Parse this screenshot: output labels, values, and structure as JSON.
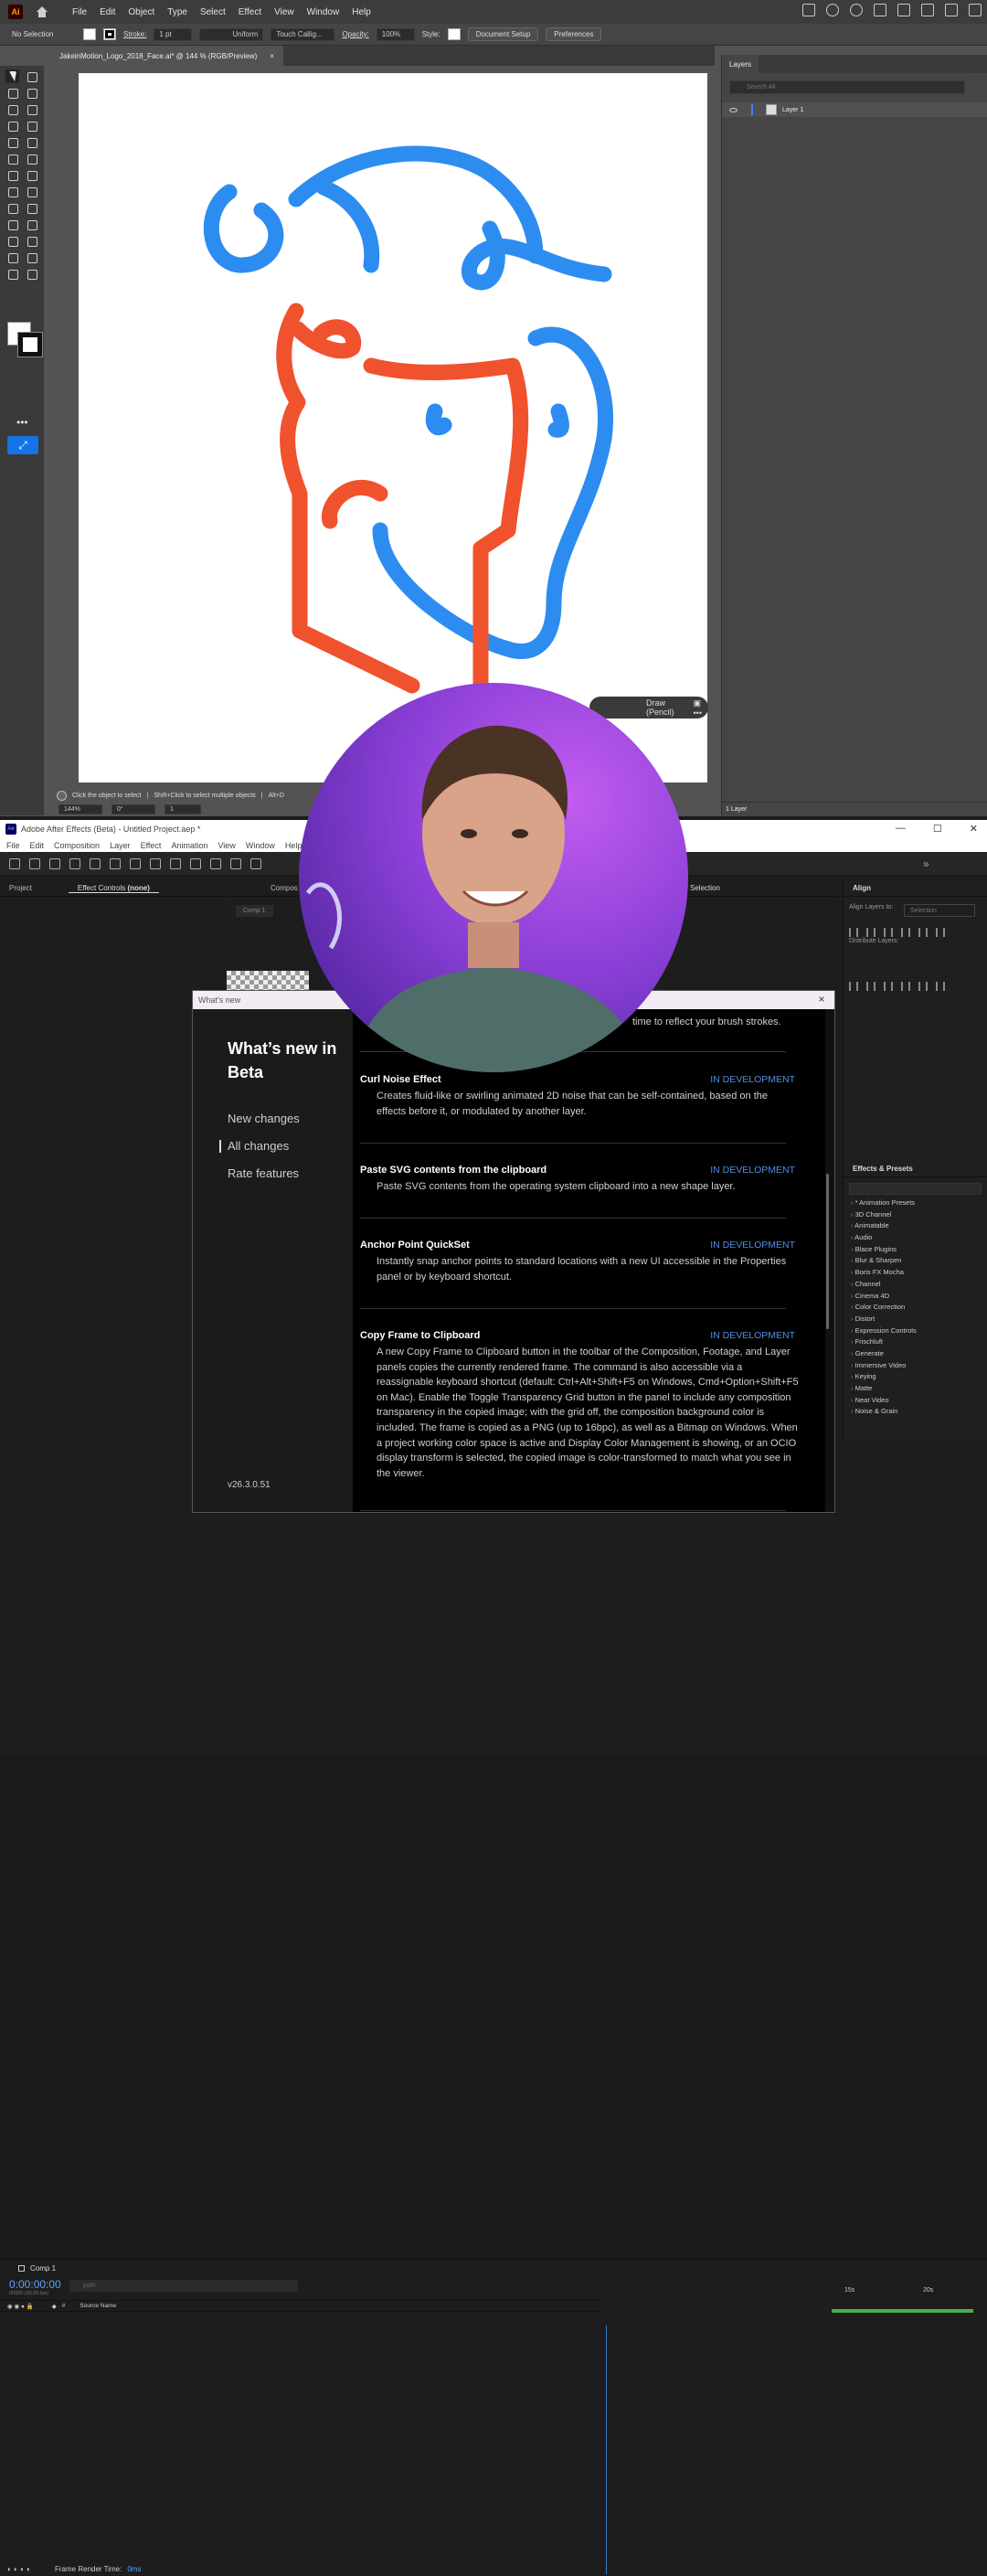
{
  "illustrator": {
    "logo": "Ai",
    "menu": [
      "File",
      "Edit",
      "Object",
      "Type",
      "Select",
      "Effect",
      "View",
      "Window",
      "Help"
    ],
    "control_bar": {
      "selection": "No Selection",
      "stroke_label": "Stroke:",
      "stroke_weight": "1 pt",
      "profile": "Uniform",
      "brush": "Touch Callig...",
      "opacity_label": "Opacity:",
      "opacity_value": "100%",
      "style_label": "Style:",
      "doc_setup": "Document Setup",
      "preferences": "Preferences"
    },
    "doc_tab": {
      "title": "JakeinMotion_Logo_2018_Face.ai* @ 144 % (RGB/Preview)",
      "close": "×"
    },
    "draw_mode": "Draw (Pencil)",
    "status": {
      "hint1": "Click the object to select",
      "hint2": "Shift+Click to select multiple objects",
      "hint3": "Alt+D"
    },
    "zoom": {
      "zoom": "144%",
      "rotation": "0°",
      "artboard": "1"
    },
    "layers": {
      "tab": "Layers",
      "search_placeholder": "Search All",
      "layer_name": "Layer 1",
      "footer": "1 Layer"
    },
    "colors": {
      "blue": "#2d8cf0",
      "orange": "#f0522d"
    }
  },
  "after_effects": {
    "title": "Adobe After Effects (Beta) - Untitled Project.aep *",
    "menu": [
      "File",
      "Edit",
      "Composition",
      "Layer",
      "Effect",
      "Animation",
      "View",
      "Window",
      "Help"
    ],
    "project_tab": "Project",
    "effect_controls_tab": "Effect Controls",
    "effect_controls_value": "(none)",
    "comp_tab": "Compos",
    "comp_chip": "Comp 1",
    "selection_tab": "Selection",
    "align": {
      "title": "Align",
      "align_to_label": "Align Layers to:",
      "align_to_value": "Selection",
      "distribute_label": "Distribute Layers:"
    },
    "effects_presets": {
      "title": "Effects & Presets",
      "items": [
        "* Animation Presets",
        "3D Channel",
        "Animatable",
        "Audio",
        "Blace Plugins",
        "Blur & Sharpen",
        "Boris FX Mocha",
        "Channel",
        "Cinema 4D",
        "Color Correction",
        "Distort",
        "Expression Controls",
        "Frischluft",
        "Generate",
        "Immersive Video",
        "Keying",
        "Matte",
        "Neat Video",
        "Noise & Grain"
      ]
    },
    "timeline": {
      "comp": "Comp 1",
      "time": "0:00:00:00",
      "fps": "00000 (30.00 fps)",
      "search_placeholder": "path",
      "source_name_col": "Source Name",
      "hash_col": "#",
      "ruler": [
        "15s",
        "20s"
      ],
      "render_label": "Frame Render Time:",
      "render_value": "0ms"
    }
  },
  "whats_new": {
    "bar_title": "What's new",
    "heading": "What’s new in Beta",
    "nav": [
      "New changes",
      "All changes",
      "Rate features"
    ],
    "current_nav": "All changes",
    "version": "v26.3.0.51",
    "top_fragment": "time to reflect your brush strokes.",
    "features": [
      {
        "title": "Curl Noise Effect",
        "status": "IN DEVELOPMENT",
        "desc": "Creates fluid-like or swirling animated 2D noise that can be self-contained, based on the effects before it, or modulated by another layer."
      },
      {
        "title": "Paste SVG contents from the clipboard",
        "status": "IN DEVELOPMENT",
        "desc": "Paste SVG contents from the operating system clipboard into a new shape layer."
      },
      {
        "title": "Anchor Point QuickSet",
        "status": "IN DEVELOPMENT",
        "desc": "Instantly snap anchor points to standard locations with a new UI accessible in the Properties panel or by keyboard shortcut."
      },
      {
        "title": "Copy Frame to Clipboard",
        "status": "IN DEVELOPMENT",
        "desc": "A new Copy Frame to Clipboard button in the toolbar of the Composition, Footage, and Layer panels copies the currently rendered frame. The command is also accessible via a reassignable keyboard shortcut (default: Ctrl+Alt+Shift+F5 on Windows, Cmd+Option+Shift+F5 on Mac). Enable the Toggle Transparency Grid button in the panel to include any composition transparency in the copied image; with the grid off, the composition background color is included. The frame is copied as a PNG (up to 16bpc), as well as a Bitmap on Windows. When a project working color space is active and Display Color Management is showing, or an OCIO display transform is selected, the copied image is color-transformed to match what you see in the viewer."
      }
    ]
  }
}
